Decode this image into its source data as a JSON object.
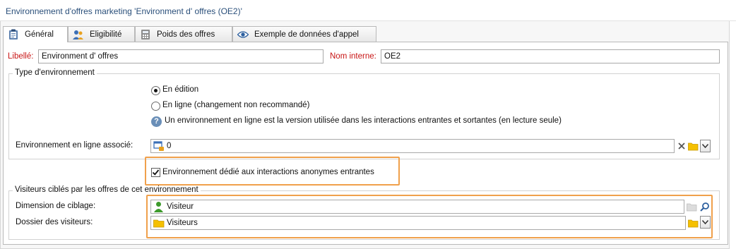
{
  "window": {
    "title": "Environnement d'offres marketing 'Environment d' offres (OE2)'"
  },
  "tabs": [
    {
      "label": "Général",
      "icon": "clipboard-icon",
      "active": true
    },
    {
      "label": "Eligibilité",
      "icon": "users-icon",
      "active": false
    },
    {
      "label": "Poids des offres",
      "icon": "calculator-icon",
      "active": false
    },
    {
      "label": "Exemple de données d'appel",
      "icon": "eye-icon",
      "active": false
    }
  ],
  "form": {
    "libelle_label": "Libellé:",
    "libelle_value": "Environment d' offres",
    "nom_interne_label": "Nom interne:",
    "nom_interne_value": "OE2"
  },
  "env_type": {
    "legend": "Type d'environnement",
    "option_edition": "En édition",
    "option_ligne": "En ligne (changement non recommandé)",
    "selected": "En édition",
    "info_text": "Un environnement en ligne est la version utilisée dans les interactions entrantes et sortantes (en lecture seule)",
    "associated_label": "Environnement en ligne associé:",
    "associated_value": "0"
  },
  "anonymous": {
    "label": "Environnement dédié aux interactions anonymes entrantes",
    "checked": true
  },
  "visitors": {
    "legend": "Visiteurs ciblés par les offres de cet environnement",
    "dimension_label": "Dimension de ciblage:",
    "dimension_value": "Visiteur",
    "folder_label": "Dossier des visiteurs:",
    "folder_value": "Visiteurs"
  },
  "colors": {
    "title_text": "#2a4f7a",
    "required_label": "#c81414",
    "highlight": "#f0a04b",
    "folder": "#f5c000",
    "person": "#3d9a2b"
  }
}
